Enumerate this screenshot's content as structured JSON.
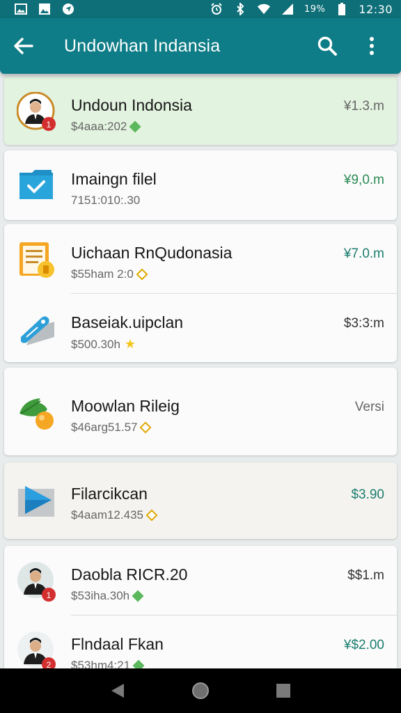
{
  "status_bar": {
    "battery": "19%",
    "time": "12:30"
  },
  "app_bar": {
    "title": "Undowhan Indansia"
  },
  "items": [
    {
      "title": "Undoun Indonsia",
      "subtitle": "$4aaa:202",
      "price": "¥1.3.m",
      "icon": "avatar-icon",
      "badge": "1"
    },
    {
      "title": "Imaingn filel",
      "subtitle": "7151:010:.30",
      "price": "¥9,0.m",
      "icon": "mail-folder-icon"
    },
    {
      "title": "Uichaan RnQudonasia",
      "subtitle": "$55ham 2:0",
      "price": "¥7.0.m",
      "icon": "document-icon"
    },
    {
      "title": "Baseiak.uipclan",
      "subtitle": "$500.30h",
      "price": "$3:3:m",
      "icon": "ticket-icon"
    },
    {
      "title": "Moowlan Rileig",
      "subtitle": "$46arg51.57",
      "price": "Versi",
      "icon": "leaf-icon"
    },
    {
      "title": "Filarcikcan",
      "subtitle": "$4aam12.435",
      "price": "$3.90",
      "icon": "play-icon"
    },
    {
      "title": "Daobla RICR.20",
      "subtitle": "$53iha.30h",
      "price": "$$1.m",
      "icon": "avatar-icon",
      "badge": "1"
    },
    {
      "title": "Flndaal Fkan",
      "subtitle": "$53hm4:21",
      "price": "¥$2.00",
      "icon": "avatar-icon",
      "badge": "2"
    }
  ],
  "colors": {
    "primary": "#0f7d87",
    "status_bar": "#0e6f78",
    "highlight_row": "#e2f3df",
    "sixth_card": "#f4f3ef",
    "price_green": "#2b8a56",
    "badge_red": "#d32f2f"
  }
}
